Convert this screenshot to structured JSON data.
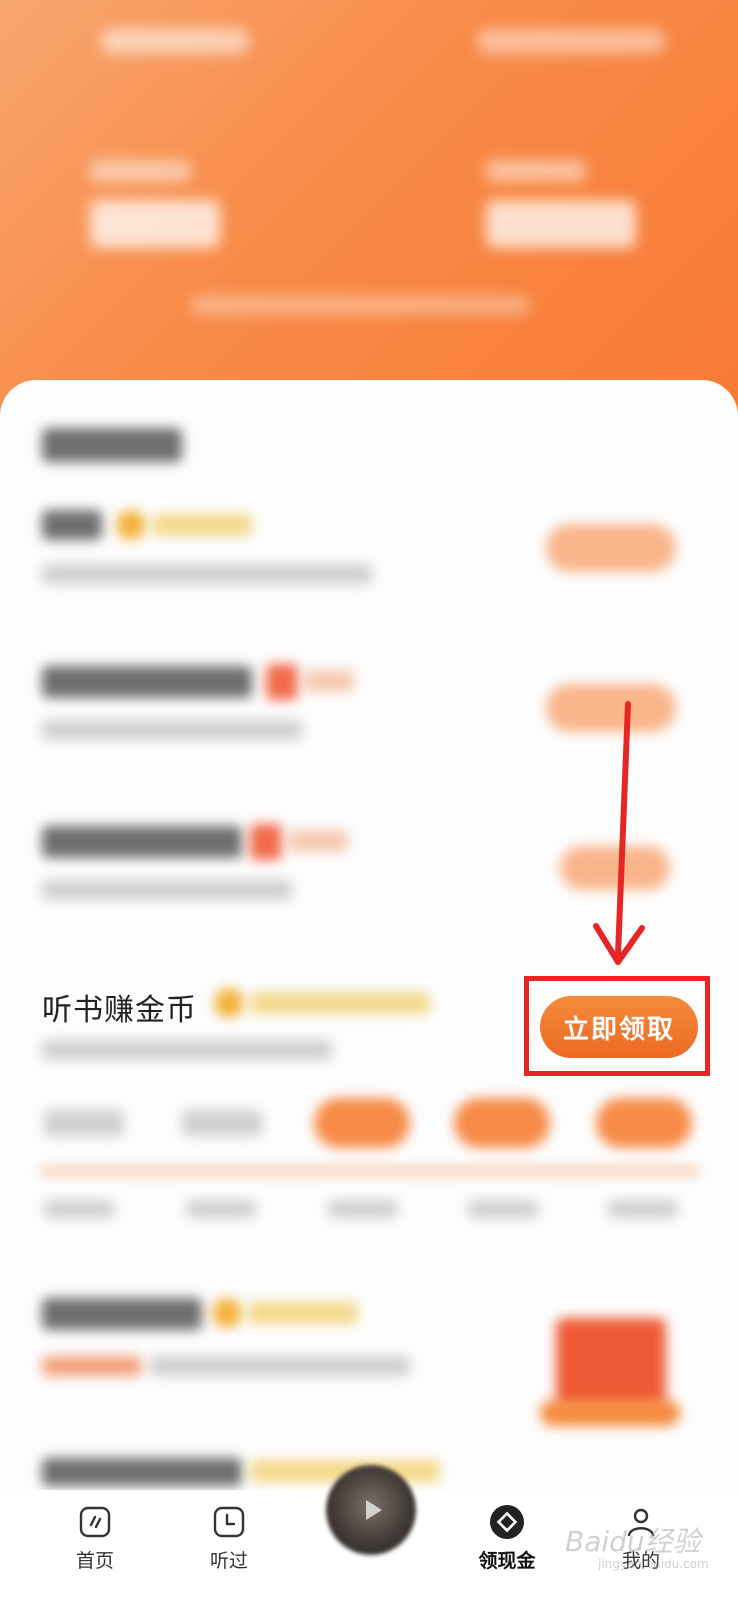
{
  "header": {
    "status": "blurred"
  },
  "featured_task": {
    "title": "听书赚金币",
    "button_label": "立即领取"
  },
  "bottom_nav": {
    "items": [
      {
        "label": "首页",
        "icon": "home-icon"
      },
      {
        "label": "听过",
        "icon": "clock-icon"
      },
      {
        "label": "领现金",
        "icon": "diamond-icon",
        "active": true
      },
      {
        "label": "我的",
        "icon": "person-icon"
      }
    ]
  },
  "watermark": {
    "brand": "Baidu经验",
    "url": "jingyan.baidu.com"
  },
  "colors": {
    "accent": "#f77a34",
    "cta": "#ec6a24",
    "highlight_frame": "#e62525",
    "arrow": "#e62525"
  }
}
